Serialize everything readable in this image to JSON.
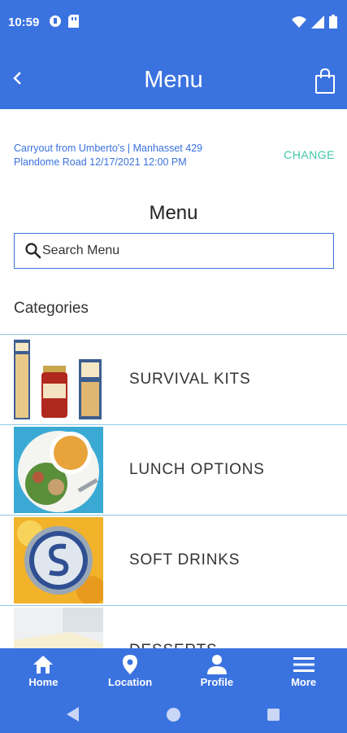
{
  "status_bar": {
    "time": "10:59",
    "left_icons": [
      "app-notification-icon",
      "sim-card-icon"
    ],
    "right_icons": [
      "wifi-icon",
      "signal-icon",
      "battery-icon"
    ]
  },
  "app_bar": {
    "title": "Menu",
    "back_icon": "chevron-left-icon",
    "cart_icon": "shopping-bag-icon"
  },
  "order_info": {
    "text": "Carryout from Umberto's | Manhasset 429 Plandome Road 12/17/2021 12:00 PM",
    "change_label": "CHANGE"
  },
  "menu_heading": "Menu",
  "search": {
    "placeholder": "Search Menu",
    "value": ""
  },
  "categories_heading": "Categories",
  "categories": [
    {
      "label": "SURVIVAL KITS",
      "image": "pasta-and-sauce-jars"
    },
    {
      "label": "LUNCH OPTIONS",
      "image": "soup-and-salad-plate"
    },
    {
      "label": "SOFT DRINKS",
      "image": "s-logo-bottle-cap"
    },
    {
      "label": "DESSERTS",
      "image": "cheesecake-slice"
    }
  ],
  "bottom_nav": [
    {
      "label": "Home",
      "icon": "home-icon"
    },
    {
      "label": "Location",
      "icon": "location-pin-icon"
    },
    {
      "label": "Profile",
      "icon": "person-icon"
    },
    {
      "label": "More",
      "icon": "menu-icon"
    }
  ],
  "colors": {
    "primary": "#3a72e0",
    "accent": "#3fc7a8",
    "divider": "#8fc8e6"
  }
}
